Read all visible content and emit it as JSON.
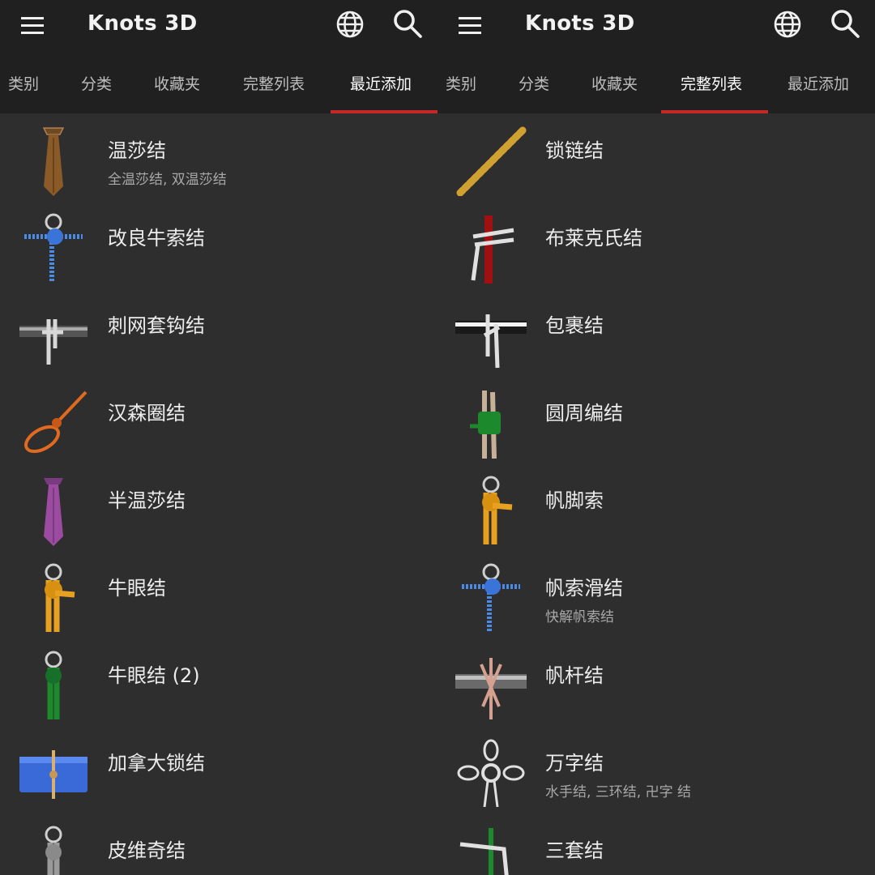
{
  "app": {
    "title": "Knots 3D"
  },
  "colors": {
    "appbar": "#202020",
    "background": "#2e2e2e",
    "accent": "#c62828"
  },
  "icons": {
    "menu": "hamburger-menu-icon",
    "language": "globe-icon",
    "search": "magnifier-icon"
  },
  "panels": [
    {
      "active_tab": "最近添加",
      "tabs": [
        {
          "label": "类别"
        },
        {
          "label": "分类"
        },
        {
          "label": "收藏夹"
        },
        {
          "label": "完整列表"
        },
        {
          "label": "最近添加"
        }
      ],
      "items": [
        {
          "title": "温莎结",
          "subtitle": "全温莎结, 双温莎结",
          "icon": "necktie-brown"
        },
        {
          "title": "改良牛索结",
          "subtitle": "",
          "icon": "ring-knot-blue"
        },
        {
          "title": "刺网套钩结",
          "subtitle": "",
          "icon": "bar-hitch-grey"
        },
        {
          "title": "汉森圈结",
          "subtitle": "",
          "icon": "noose-loop-orange"
        },
        {
          "title": "半温莎结",
          "subtitle": "",
          "icon": "necktie-purple"
        },
        {
          "title": "牛眼结",
          "subtitle": "",
          "icon": "ring-knot-yellow"
        },
        {
          "title": "牛眼结 (2)",
          "subtitle": "",
          "icon": "ring-knot-green"
        },
        {
          "title": "加拿大锁结",
          "subtitle": "",
          "icon": "blue-pad-knot"
        },
        {
          "title": "皮维奇结",
          "subtitle": "",
          "icon": "ring-knot-grey"
        }
      ]
    },
    {
      "active_tab": "完整列表",
      "tabs": [
        {
          "label": "类别"
        },
        {
          "label": "分类"
        },
        {
          "label": "收藏夹"
        },
        {
          "label": "完整列表"
        },
        {
          "label": "最近添加"
        }
      ],
      "items": [
        {
          "title": "锁链结",
          "subtitle": "",
          "icon": "chain-sinnet-gold"
        },
        {
          "title": "布莱克氏结",
          "subtitle": "",
          "icon": "pole-hitch-red-white"
        },
        {
          "title": "包裹结",
          "subtitle": "",
          "icon": "bar-hitch-white"
        },
        {
          "title": "圆周编结",
          "subtitle": "",
          "icon": "poles-lashing-green"
        },
        {
          "title": "帆脚索",
          "subtitle": "",
          "icon": "ring-knot-yellow"
        },
        {
          "title": "帆索滑结",
          "subtitle": "快解帆索结",
          "icon": "ring-knot-blue"
        },
        {
          "title": "帆杆结",
          "subtitle": "",
          "icon": "bar-hitch-pink"
        },
        {
          "title": "万字结",
          "subtitle": "水手结, 三环结, 卍字 结",
          "icon": "cross-knot-white"
        },
        {
          "title": "三套结",
          "subtitle": "",
          "icon": "green-white-knot"
        }
      ]
    }
  ]
}
